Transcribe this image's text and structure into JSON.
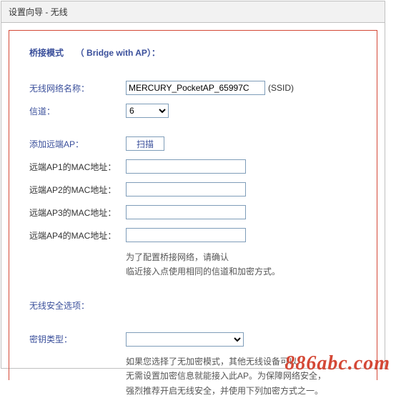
{
  "header": {
    "title": "设置向导 - 无线"
  },
  "mode": {
    "label": "桥接模式",
    "english": "（ Bridge with AP）："
  },
  "form": {
    "ssid_label": "无线网络名称：",
    "ssid_value": "MERCURY_PocketAP_65997C",
    "ssid_suffix": "(SSID)",
    "channel_label": "信道：",
    "channel_value": "6",
    "add_ap_label": "添加远端AP：",
    "scan_button": "扫描",
    "mac1_label": "远端AP1的MAC地址：",
    "mac1_value": "",
    "mac2_label": "远端AP2的MAC地址：",
    "mac2_value": "",
    "mac3_label": "远端AP3的MAC地址：",
    "mac3_value": "",
    "mac4_label": "远端AP4的MAC地址：",
    "mac4_value": "",
    "bridge_hint1": "为了配置桥接网络，请确认",
    "bridge_hint2": "临近接入点使用相同的信道和加密方式。"
  },
  "security": {
    "section_title": "无线安全选项：",
    "key_type_label": "密钥类型：",
    "key_type_value": "",
    "hint1": "如果您选择了无加密模式，其他无线设备可以",
    "hint2": "无需设置加密信息就能接入此AP。为保障网络安全，",
    "hint3": "强烈推荐开启无线安全，并使用下列加密方式之一。"
  },
  "watermark": "886abc.com"
}
